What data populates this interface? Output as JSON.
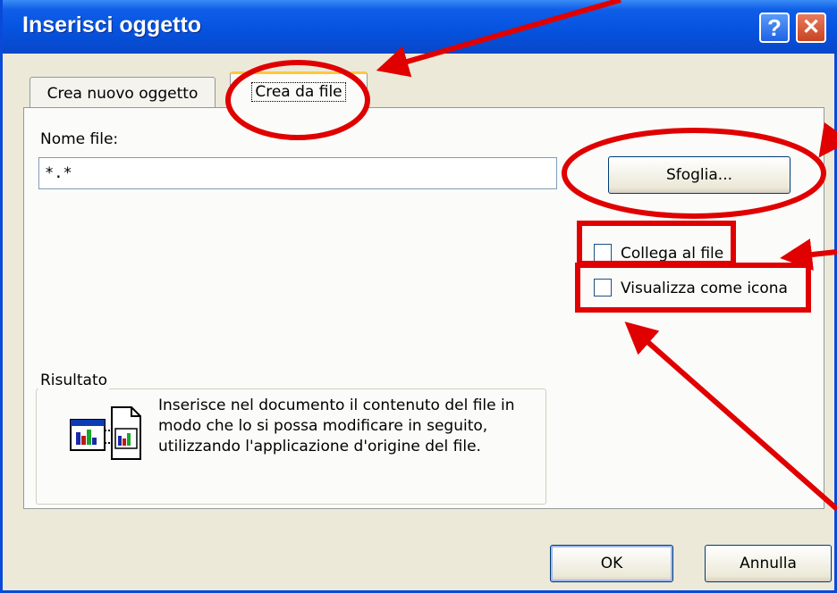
{
  "dialog": {
    "title": "Inserisci oggetto",
    "help_glyph": "?",
    "close_glyph": "✕"
  },
  "tabs": [
    {
      "label": "Crea nuovo oggetto",
      "active": false
    },
    {
      "label": "Crea da file",
      "active": true
    }
  ],
  "file": {
    "label": "Nome file:",
    "value": "*.*",
    "browse_label": "Sfoglia..."
  },
  "options": {
    "link_label": "Collega al file",
    "link_checked": false,
    "icon_label": "Visualizza come icona",
    "icon_checked": false
  },
  "result": {
    "legend": "Risultato",
    "text": "Inserisce nel documento il contenuto del file in modo che lo si possa modificare in seguito, utilizzando l'applicazione d'origine del file."
  },
  "buttons": {
    "ok_label": "OK",
    "cancel_label": "Annulla"
  },
  "annotation_color": "#e00000"
}
